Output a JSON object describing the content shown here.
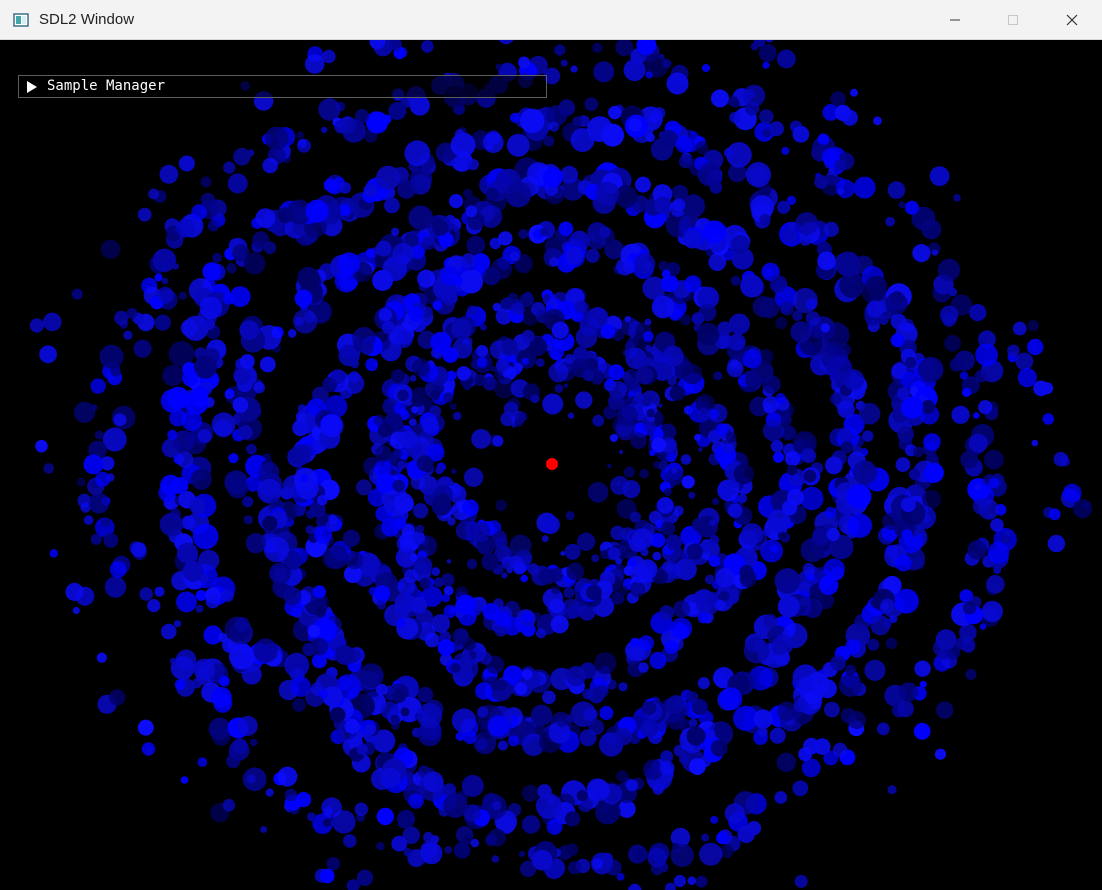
{
  "window": {
    "title": "SDL2 Window"
  },
  "controls": {
    "minimize_icon": "minimize-icon",
    "maximize_icon": "maximize-icon",
    "close_icon": "close-icon"
  },
  "sample_manager": {
    "label": "Sample Manager",
    "expand_icon": "triangle-right-icon"
  },
  "scene": {
    "background": "#000000",
    "particle_color": "#0000ff",
    "center_marker_color": "#ff0000"
  }
}
